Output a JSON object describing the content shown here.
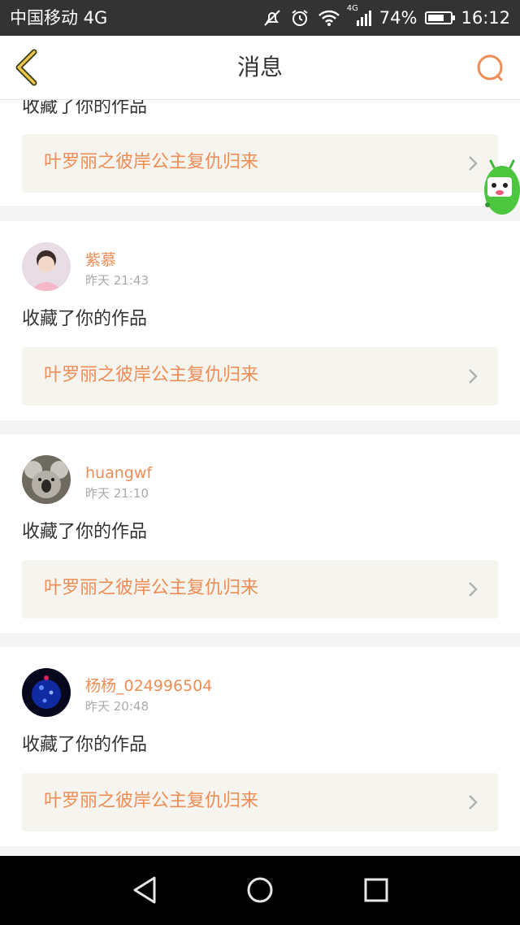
{
  "status_bar": {
    "carrier": "中国移动 4G",
    "network": "4G",
    "battery_text": "74%",
    "battery_level": 0.74,
    "time": "16:12"
  },
  "header": {
    "title": "消息",
    "back_icon": "back-chevron-icon",
    "search_icon": "search-icon"
  },
  "colors": {
    "accent": "#ee8d55",
    "card_bg": "#ffffff",
    "work_bg": "#f5f4ee",
    "back_icon": "#c89a3a"
  },
  "messages": [
    {
      "action": "收藏了你的作品",
      "work_title": "叶罗丽之彼岸公主复仇归来"
    },
    {
      "username": "紫慕",
      "time": "昨天 21:43",
      "action": "收藏了你的作品",
      "work_title": "叶罗丽之彼岸公主复仇归来"
    },
    {
      "username": "huangwf",
      "time": "昨天 21:10",
      "action": "收藏了你的作品",
      "work_title": "叶罗丽之彼岸公主复仇归来"
    },
    {
      "username": "杨杨_024996504",
      "time": "昨天 20:48",
      "action": "收藏了你的作品",
      "work_title": "叶罗丽之彼岸公主复仇归来"
    }
  ],
  "nav_bar": {
    "back_icon": "triangle-back-icon",
    "home_icon": "circle-home-icon",
    "recents_icon": "square-recents-icon"
  }
}
